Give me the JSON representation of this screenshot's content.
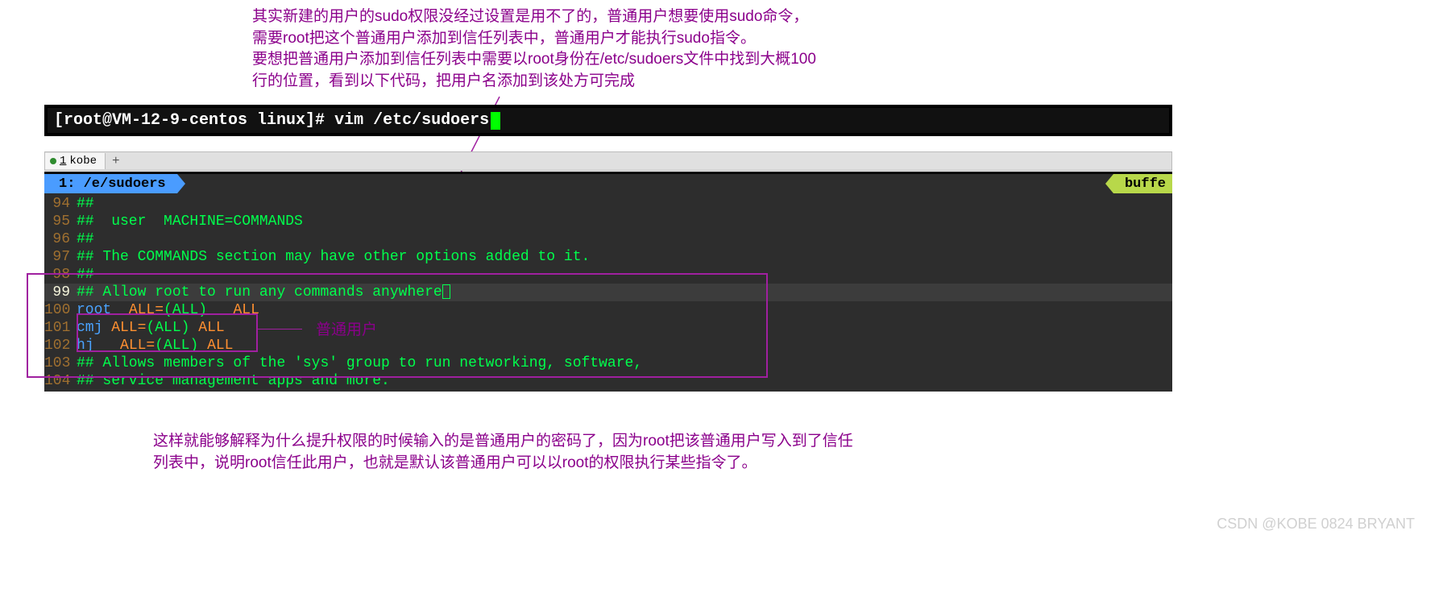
{
  "annotations": {
    "top": "其实新建的用户的sudo权限没经过设置是用不了的，普通用户想要使用sudo命令，\n需要root把这个普通用户添加到信任列表中，普通用户才能执行sudo指令。\n要想把普通用户添加到信任列表中需要以root身份在/etc/sudoers文件中找到大概100\n行的位置，看到以下代码，把用户名添加到该处方可完成",
    "mid_label": "普通用户",
    "bottom": "这样就能够解释为什么提升权限的时候输入的是普通用户的密码了，因为root把该普通用户写入到了信任\n列表中，说明root信任此用户，也就是默认该普通用户可以以root的权限执行某些指令了。"
  },
  "terminal": {
    "prompt": "[root@VM-12-9-centos linux]#",
    "command": "vim /etc/sudoers"
  },
  "tab": {
    "index": "1",
    "name": "kobe"
  },
  "editor": {
    "filepath": "1: /e/sudoers",
    "buffer_label": "buffe",
    "lines": [
      {
        "no": "94",
        "plain": "##"
      },
      {
        "no": "95",
        "plain": "##  user  MACHINE=COMMANDS"
      },
      {
        "no": "96",
        "plain": "##"
      },
      {
        "no": "97",
        "plain": "## The COMMANDS section may have other options added to it."
      },
      {
        "no": "98",
        "plain": "##"
      },
      {
        "no": "99",
        "plain": "## Allow root to run any commands anywhere",
        "active": true,
        "cursor": true
      },
      {
        "no": "100",
        "user": "root",
        "pre": "  ",
        "perm_l": "ALL=",
        "perm_p": "(ALL)",
        "mid": "   ",
        "perm_r": "ALL"
      },
      {
        "no": "101",
        "user": "cmj",
        "pre": " ",
        "perm_l": "ALL=",
        "perm_p": "(ALL)",
        "mid": " ",
        "perm_r": "ALL"
      },
      {
        "no": "102",
        "user": "hj",
        "pre": "   ",
        "perm_l": "ALL=",
        "perm_p": "(ALL)",
        "mid": " ",
        "perm_r": "ALL"
      },
      {
        "no": "103",
        "plain": "## Allows members of the 'sys' group to run networking, software,"
      },
      {
        "no": "104",
        "plain": "## service management apps and more."
      }
    ]
  },
  "watermark": "CSDN @KOBE 0824 BRYANT"
}
